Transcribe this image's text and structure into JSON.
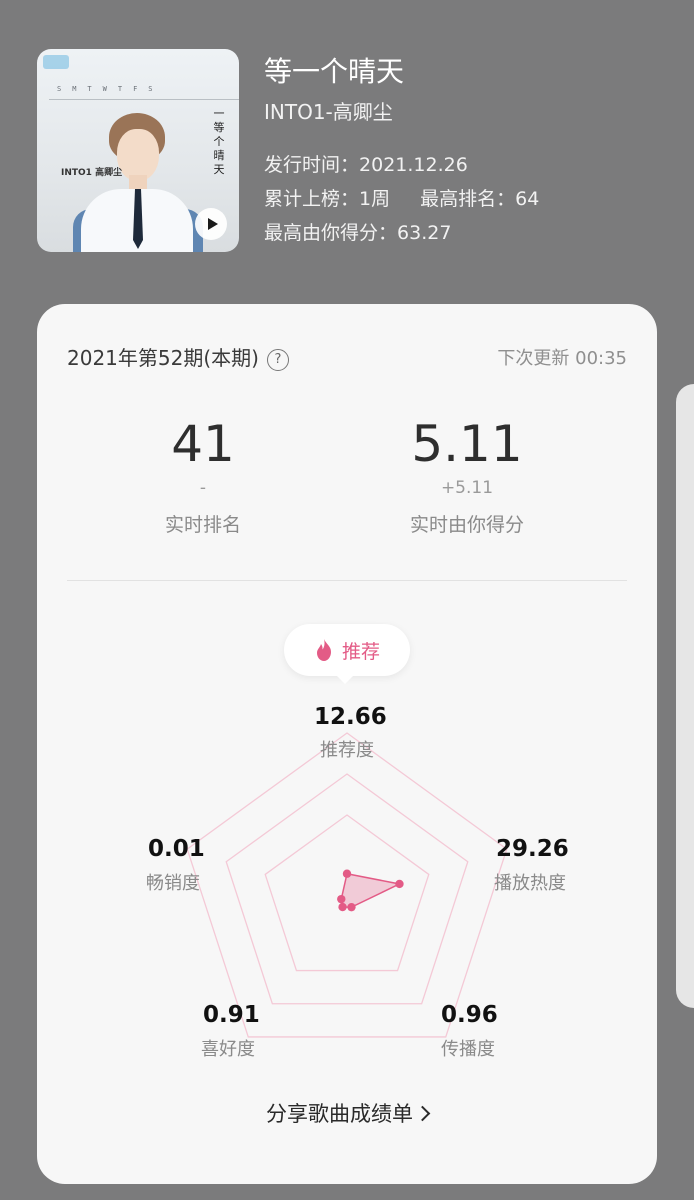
{
  "song": {
    "title": "等一个晴天",
    "artist": "INTO1-高卿尘",
    "release_label": "发行时间：",
    "release_date": "2021.12.26",
    "weeks_label": "累计上榜：",
    "weeks_value": "1周",
    "peak_label": "最高排名：",
    "peak_value": "64",
    "best_score_label": "最高由你得分：",
    "best_score_value": "63.27"
  },
  "cover": {
    "weekdays": "SMTWTFS",
    "caption": "INTO1 高卿尘",
    "side_title": "一等个晴天"
  },
  "card": {
    "period": "2021年第52期(本期)",
    "help_icon": "question-circle-icon",
    "next_update_label": "下次更新",
    "next_update_time": "00:35",
    "rank": {
      "value": "41",
      "delta": "-",
      "label": "实时排名"
    },
    "score": {
      "value": "5.11",
      "delta": "+5.11",
      "label": "实时由你得分"
    },
    "badge": {
      "icon": "fire-icon",
      "label": "推荐"
    },
    "share_label": "分享歌曲成绩单"
  },
  "radar": {
    "recommend": {
      "value": "12.66",
      "label": "推荐度"
    },
    "play_heat": {
      "value": "29.26",
      "label": "播放热度"
    },
    "spread": {
      "value": "0.96",
      "label": "传播度"
    },
    "like": {
      "value": "0.91",
      "label": "喜好度"
    },
    "sales": {
      "value": "0.01",
      "label": "畅销度"
    }
  },
  "colors": {
    "accent": "#e35b86",
    "grid": "#f4c9d6",
    "background": "#7b7b7c",
    "card": "#f7f7f7"
  }
}
